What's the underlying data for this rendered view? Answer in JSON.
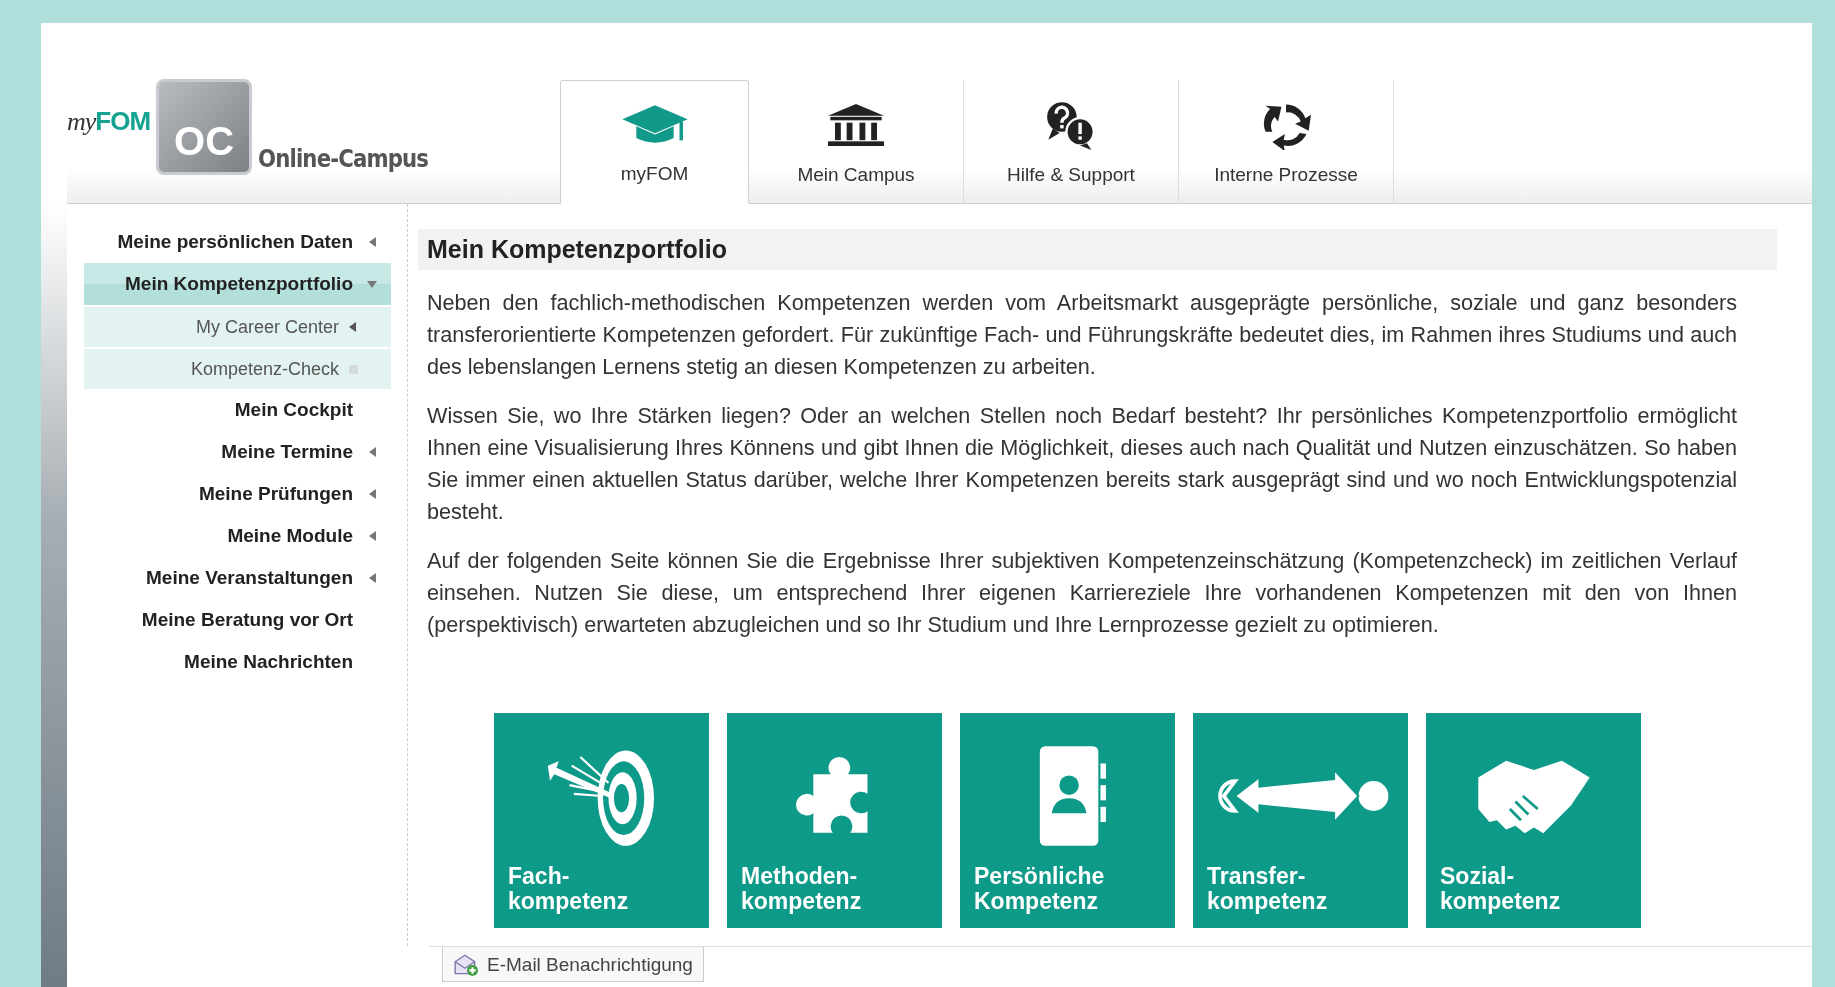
{
  "logo": {
    "brand_prefix": "my",
    "brand": "FOM",
    "badge": "OC",
    "subtitle": "Online-Campus"
  },
  "tabs": [
    {
      "label": "myFOM",
      "selected": true
    },
    {
      "label": "Mein Campus",
      "selected": false
    },
    {
      "label": "Hilfe & Support",
      "selected": false
    },
    {
      "label": "Interne Prozesse",
      "selected": false
    }
  ],
  "sidebar": {
    "items": [
      {
        "label": "Meine persönlichen Daten",
        "kind": "folder",
        "selected": false,
        "expanded": false
      },
      {
        "label": "Mein Kompetenzportfolio",
        "kind": "folder",
        "selected": true,
        "expanded": true,
        "children": [
          {
            "label": "My Career Center",
            "kind": "folder",
            "selected": false,
            "expanded": false
          },
          {
            "label": "Kompetenz-Check",
            "kind": "page",
            "selected": false
          }
        ]
      },
      {
        "label": "Mein Cockpit",
        "kind": "link",
        "selected": false
      },
      {
        "label": "Meine Termine",
        "kind": "folder",
        "selected": false,
        "expanded": false
      },
      {
        "label": "Meine Prüfungen",
        "kind": "folder",
        "selected": false,
        "expanded": false
      },
      {
        "label": "Meine Module",
        "kind": "folder",
        "selected": false,
        "expanded": false
      },
      {
        "label": "Meine Veranstaltungen",
        "kind": "folder",
        "selected": false,
        "expanded": false
      },
      {
        "label": "Meine Beratung vor Ort",
        "kind": "link",
        "selected": false
      },
      {
        "label": "Meine Nachrichten",
        "kind": "link",
        "selected": false
      }
    ]
  },
  "content": {
    "title": "Mein Kompetenzportfolio",
    "paragraphs": [
      "Neben den fachlich-methodischen Kompetenzen werden vom Arbeitsmarkt ausgeprägte persönliche, soziale und ganz besonders transferorientierte Kompetenzen gefordert. Für zukünftige Fach- und Führungskräfte bedeutet dies, im Rahmen ihres Studiums und auch des lebenslangen Lernens stetig an diesen Kompetenzen zu arbeiten.",
      "Wissen Sie, wo Ihre Stärken liegen? Oder an welchen Stellen noch Bedarf besteht? Ihr persönliches Kompetenzportfolio ermöglicht Ihnen eine Visualisierung Ihres Könnens und gibt Ihnen die Möglichkeit, dieses auch nach Qualität und Nutzen einzuschätzen. So haben Sie immer einen aktuellen Status darüber, welche Ihrer Kompetenzen bereits stark ausgeprägt sind und wo noch Entwicklungspotenzial besteht.",
      "Auf der folgenden Seite können Sie die Ergebnisse Ihrer subjektiven Kompetenzeinschätzung (Kompetenzcheck) im zeitlichen Verlauf einsehen. Nutzen Sie diese, um entsprechend Ihrer eigenen Karriereziele Ihre vorhandenen Kompetenzen mit den von Ihnen (perspektivisch) erwarteten abzugleichen und so Ihr Studium und Ihre Lernprozesse gezielt zu optimieren."
    ],
    "tiles": [
      {
        "kind": "target",
        "label": "Fach-\nkompetenz"
      },
      {
        "kind": "puzzle",
        "label": "Methoden-\nkompetenz"
      },
      {
        "kind": "contact",
        "label": "Persönliche\nKompetenz"
      },
      {
        "kind": "transfer",
        "label": "Transfer-\nkompetenz"
      },
      {
        "kind": "handshake",
        "label": "Sozial-\nkompetenz"
      }
    ]
  },
  "footer_tab": {
    "label": "E-Mail Benachrichtigung"
  }
}
